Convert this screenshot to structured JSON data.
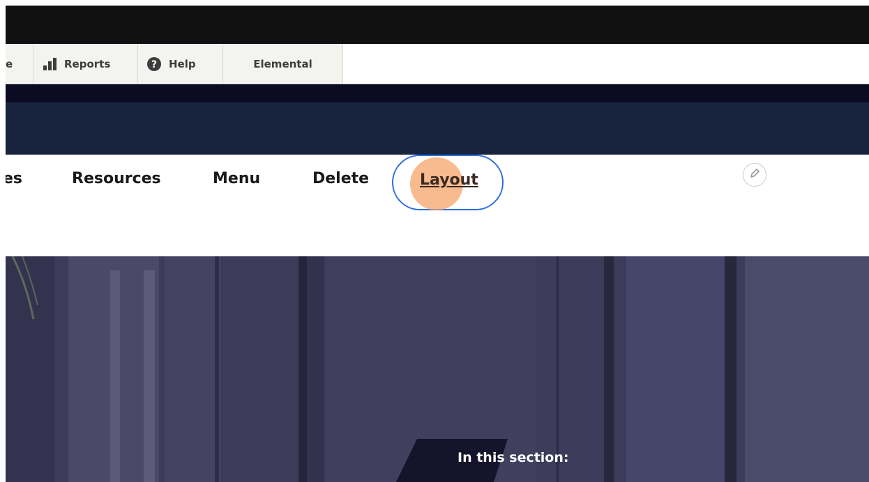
{
  "toolbar": {
    "partial_label": "e",
    "items": [
      {
        "label": "Reports",
        "icon": "bar-chart-icon"
      },
      {
        "label": "Help",
        "icon": "help-circle-icon"
      },
      {
        "label": "Elemental"
      }
    ]
  },
  "tabs": {
    "partial_label": "es",
    "items": [
      {
        "label": "Resources"
      },
      {
        "label": "Menu"
      },
      {
        "label": "Delete"
      },
      {
        "label": "Layout",
        "highlighted": true
      }
    ],
    "edit_icon": "pencil-icon"
  },
  "hero": {
    "heading": "In this section:"
  },
  "colors": {
    "topbar": "#111111",
    "navy_band": "#18233d",
    "dark_strip": "#0b0b24",
    "highlight_ring": "#2f6fdd",
    "click_indicator": "#f5a064"
  }
}
